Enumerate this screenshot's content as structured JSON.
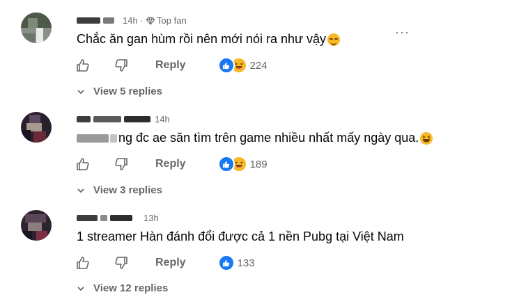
{
  "comments": [
    {
      "time": "14h",
      "badge": "Top fan",
      "text": "Chắc ăn gan hùm rồi nên mới nói ra như vậy",
      "reply_label": "Reply",
      "reaction_count": "224",
      "view_replies": "View 5 replies"
    },
    {
      "time": "14h",
      "text": "ng đc ae săn tìm trên game nhiều nhất mấy ngày qua.",
      "reply_label": "Reply",
      "reaction_count": "189",
      "view_replies": "View 3 replies"
    },
    {
      "time": "13h",
      "text": "1 streamer Hàn đánh đổi được cả 1 nền Pubg tại Việt Nam",
      "reply_label": "Reply",
      "reaction_count": "133",
      "view_replies": "View 12 replies"
    }
  ],
  "more_options": "···",
  "icons": {
    "like": "thumbs-up-icon",
    "dislike": "thumbs-down-icon",
    "like_reaction": "like-reaction-icon",
    "haha_reaction": "haha-reaction-icon",
    "top_fan": "diamond-badge-icon",
    "expand": "chevron-down-icon"
  },
  "colors": {
    "like_blue": "#1877f2",
    "haha_yellow": "#f7b928",
    "secondary_text": "#65676b"
  }
}
